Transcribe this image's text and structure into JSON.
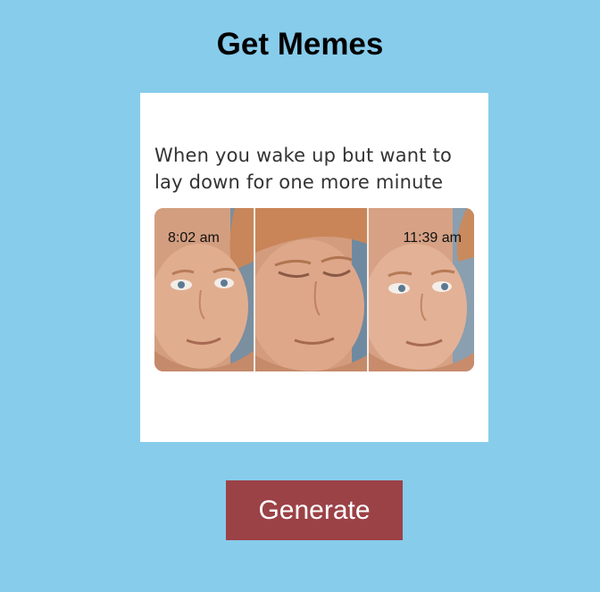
{
  "header": {
    "title": "Get Memes"
  },
  "meme": {
    "caption": "When you wake up but want to lay down for one more minute",
    "panels": [
      {
        "time": "8:02 am",
        "subject": "face-eyes-open-icon"
      },
      {
        "time": "",
        "subject": "face-blinking-icon"
      },
      {
        "time": "11:39 am",
        "subject": "face-eyes-open-icon"
      }
    ]
  },
  "actions": {
    "generate_label": "Generate"
  },
  "colors": {
    "background": "#87cceb",
    "button": "#9b4247",
    "button_text": "#ffffff",
    "card": "#ffffff"
  }
}
